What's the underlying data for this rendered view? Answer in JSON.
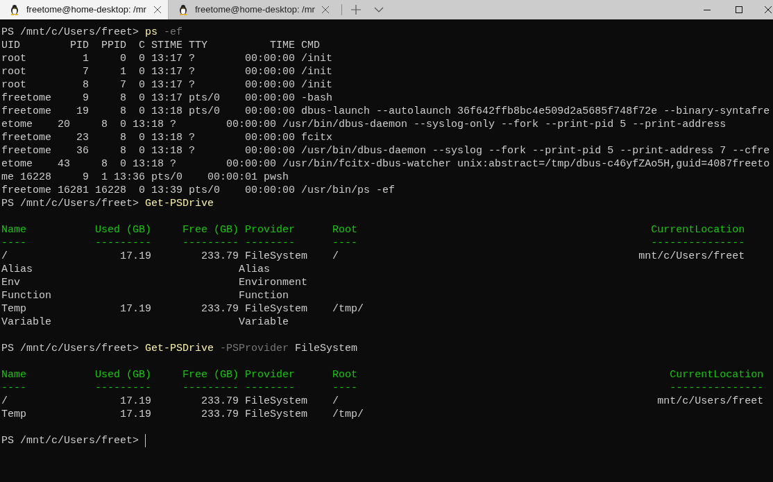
{
  "tabs": [
    {
      "title": "freetome@home-desktop: /mr",
      "selected": true
    },
    {
      "title": "freetome@home-desktop: /mr",
      "selected": false
    }
  ],
  "terminal": {
    "lines": [
      {
        "kind": "text",
        "segments": [
          {
            "kind": "prompt",
            "text": "PS /mnt/c/Users/freet> "
          },
          {
            "kind": "command",
            "text": "ps"
          },
          {
            "kind": "parameter",
            "text": " -ef"
          }
        ]
      },
      {
        "kind": "text",
        "segments": [
          {
            "kind": "output",
            "text": "UID        PID  PPID  C STIME TTY          TIME CMD"
          }
        ]
      },
      {
        "kind": "text",
        "segments": [
          {
            "kind": "output",
            "text": "root         1     0  0 13:17 ?        00:00:00 /init"
          }
        ]
      },
      {
        "kind": "text",
        "segments": [
          {
            "kind": "output",
            "text": "root         7     1  0 13:17 ?        00:00:00 /init"
          }
        ]
      },
      {
        "kind": "text",
        "segments": [
          {
            "kind": "output",
            "text": "root         8     7  0 13:17 ?        00:00:00 /init"
          }
        ]
      },
      {
        "kind": "text",
        "segments": [
          {
            "kind": "output",
            "text": "freetome     9     8  0 13:17 pts/0    00:00:00 -bash"
          }
        ]
      },
      {
        "kind": "text",
        "segments": [
          {
            "kind": "output",
            "text": "freetome    19     8  0 13:18 pts/0    00:00:00 dbus-launch --autolaunch 36f642ffb8bc4e509d2a5685f748f72e --binary-syntafre"
          }
        ]
      },
      {
        "kind": "text",
        "segments": [
          {
            "kind": "output",
            "text": "etome    20     8  0 13:18 ?        00:00:00 /usr/bin/dbus-daemon --syslog-only --fork --print-pid 5 --print-address"
          }
        ]
      },
      {
        "kind": "text",
        "segments": [
          {
            "kind": "output",
            "text": "freetome    23     8  0 13:18 ?        00:00:00 fcitx"
          }
        ]
      },
      {
        "kind": "text",
        "segments": [
          {
            "kind": "output",
            "text": "freetome    36     8  0 13:18 ?        00:00:00 /usr/bin/dbus-daemon --syslog --fork --print-pid 5 --print-address 7 --cfre"
          }
        ]
      },
      {
        "kind": "text",
        "segments": [
          {
            "kind": "output",
            "text": "etome    43     8  0 13:18 ?        00:00:00 /usr/bin/fcitx-dbus-watcher unix:abstract=/tmp/dbus-c46yfZAo5H,guid=4087freeto"
          }
        ]
      },
      {
        "kind": "text",
        "segments": [
          {
            "kind": "output",
            "text": "me 16228     9  1 13:36 pts/0    00:00:01 pwsh"
          }
        ]
      },
      {
        "kind": "text",
        "segments": [
          {
            "kind": "output",
            "text": "freetome 16281 16228  0 13:39 pts/0    00:00:00 /usr/bin/ps -ef"
          }
        ]
      },
      {
        "kind": "text",
        "segments": [
          {
            "kind": "prompt",
            "text": "PS /mnt/c/Users/freet> "
          },
          {
            "kind": "command",
            "text": "Get-PSDrive"
          }
        ]
      },
      {
        "kind": "blank"
      },
      {
        "kind": "text",
        "segments": [
          {
            "kind": "header",
            "text": "Name           Used (GB)     Free (GB) Provider      Root                                               CurrentLocation"
          }
        ]
      },
      {
        "kind": "text",
        "segments": [
          {
            "kind": "header",
            "text": "----           ---------     --------- --------      ----                                               ---------------"
          }
        ]
      },
      {
        "kind": "text",
        "segments": [
          {
            "kind": "output",
            "text": "/                  17.19        233.79 FileSystem    /                                                mnt/c/Users/freet"
          }
        ]
      },
      {
        "kind": "text",
        "segments": [
          {
            "kind": "output",
            "text": "Alias                                 Alias"
          }
        ]
      },
      {
        "kind": "text",
        "segments": [
          {
            "kind": "output",
            "text": "Env                                   Environment"
          }
        ]
      },
      {
        "kind": "text",
        "segments": [
          {
            "kind": "output",
            "text": "Function                              Function"
          }
        ]
      },
      {
        "kind": "text",
        "segments": [
          {
            "kind": "output",
            "text": "Temp               17.19        233.79 FileSystem    /tmp/"
          }
        ]
      },
      {
        "kind": "text",
        "segments": [
          {
            "kind": "output",
            "text": "Variable                              Variable"
          }
        ]
      },
      {
        "kind": "blank"
      },
      {
        "kind": "text",
        "segments": [
          {
            "kind": "prompt",
            "text": "PS /mnt/c/Users/freet> "
          },
          {
            "kind": "command",
            "text": "Get-PSDrive"
          },
          {
            "kind": "parameter",
            "text": " -PSProvider"
          },
          {
            "kind": "argument",
            "text": " FileSystem"
          }
        ]
      },
      {
        "kind": "blank"
      },
      {
        "kind": "text",
        "segments": [
          {
            "kind": "header",
            "text": "Name           Used (GB)     Free (GB) Provider      Root                                                  CurrentLocation"
          }
        ]
      },
      {
        "kind": "text",
        "segments": [
          {
            "kind": "header",
            "text": "----           ---------     --------- --------      ----                                                  ---------------"
          }
        ]
      },
      {
        "kind": "text",
        "segments": [
          {
            "kind": "output",
            "text": "/                  17.19        233.79 FileSystem    /                                                   mnt/c/Users/freet"
          }
        ]
      },
      {
        "kind": "text",
        "segments": [
          {
            "kind": "output",
            "text": "Temp               17.19        233.79 FileSystem    /tmp/"
          }
        ]
      },
      {
        "kind": "blank"
      },
      {
        "kind": "text",
        "segments": [
          {
            "kind": "prompt",
            "text": "PS /mnt/c/Users/freet> "
          }
        ],
        "cursor": true
      }
    ]
  }
}
